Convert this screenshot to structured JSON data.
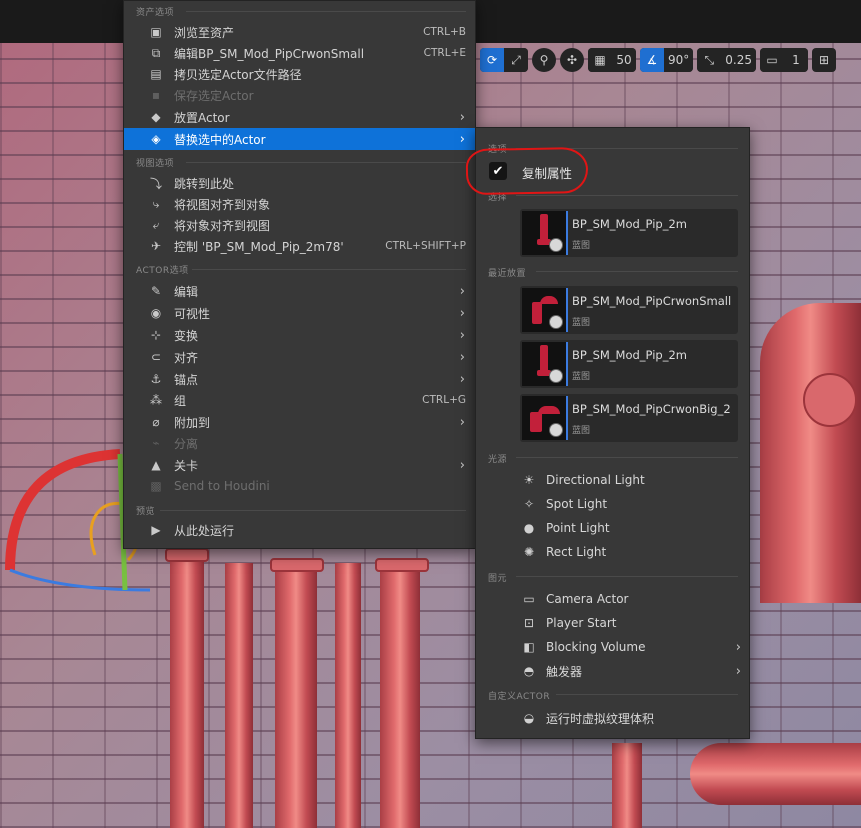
{
  "toolbar": {
    "grid_value": "50",
    "angle_value": "90°",
    "scale_value": "0.25",
    "camera_speed": "1"
  },
  "main_menu": {
    "sections": {
      "asset": "资产选项",
      "view": "视图选项",
      "actor": "ACTOR选项",
      "preview": "预览"
    },
    "items": [
      {
        "label": "浏览至资产",
        "shortcut": "CTRL+B",
        "icon": "browse-icon"
      },
      {
        "label": "编辑BP_SM_Mod_PipCrwonSmall",
        "shortcut": "CTRL+E",
        "icon": "edit-blueprint-icon"
      },
      {
        "label": "拷贝选定Actor文件路径",
        "shortcut": "",
        "icon": "copy-path-icon"
      },
      {
        "label": "保存选定Actor",
        "shortcut": "",
        "icon": "save-icon",
        "disabled": true
      },
      {
        "label": "放置Actor",
        "shortcut": "",
        "icon": "place-actor-icon",
        "submenu": true
      },
      {
        "label": "替换选中的Actor",
        "shortcut": "",
        "icon": "replace-actor-icon",
        "submenu": true,
        "highlighted": true
      },
      {
        "label": "跳转到此处",
        "shortcut": "",
        "icon": "jump-icon"
      },
      {
        "label": "将视图对齐到对象",
        "shortcut": "",
        "icon": "snap-view-icon"
      },
      {
        "label": "将对象对齐到视图",
        "shortcut": "",
        "icon": "snap-object-icon"
      },
      {
        "label": "控制 'BP_SM_Mod_Pip_2m78'",
        "shortcut": "CTRL+SHIFT+P",
        "icon": "pilot-icon"
      },
      {
        "label": "编辑",
        "shortcut": "",
        "icon": "pencil-icon",
        "submenu": true
      },
      {
        "label": "可视性",
        "shortcut": "",
        "icon": "eye-icon",
        "submenu": true
      },
      {
        "label": "变换",
        "shortcut": "",
        "icon": "transform-icon",
        "submenu": true
      },
      {
        "label": "对齐",
        "shortcut": "",
        "icon": "magnet-icon",
        "submenu": true
      },
      {
        "label": "锚点",
        "shortcut": "",
        "icon": "pivot-icon",
        "submenu": true
      },
      {
        "label": "组",
        "shortcut": "CTRL+G",
        "icon": "group-icon"
      },
      {
        "label": "附加到",
        "shortcut": "",
        "icon": "attach-icon",
        "submenu": true
      },
      {
        "label": "分离",
        "shortcut": "",
        "icon": "detach-icon",
        "disabled": true
      },
      {
        "label": "关卡",
        "shortcut": "",
        "icon": "level-icon",
        "submenu": true
      },
      {
        "label": "Send to Houdini",
        "shortcut": "",
        "icon": "houdini-icon",
        "disabled": true
      },
      {
        "label": "从此处运行",
        "shortcut": "",
        "icon": "play-icon"
      }
    ]
  },
  "sub_menu": {
    "sections": {
      "options": "选项",
      "selection": "选择",
      "recent": "最近放置",
      "lights": "光源",
      "basic": "图元",
      "custom": "自定义ACTOR"
    },
    "copy_properties": {
      "label": "复制属性",
      "checked": true
    },
    "selected_asset": {
      "name": "BP_SM_Mod_Pip_2m",
      "type": "蓝图"
    },
    "recent_assets": [
      {
        "name": "BP_SM_Mod_PipCrwonSmall",
        "type": "蓝图"
      },
      {
        "name": "BP_SM_Mod_Pip_2m",
        "type": "蓝图"
      },
      {
        "name": "BP_SM_Mod_PipCrwonBig_2",
        "type": "蓝图"
      }
    ],
    "lights": [
      {
        "label": "Directional Light",
        "icon": "directional-light-icon"
      },
      {
        "label": "Spot Light",
        "icon": "spot-light-icon"
      },
      {
        "label": "Point Light",
        "icon": "point-light-icon"
      },
      {
        "label": "Rect Light",
        "icon": "rect-light-icon"
      }
    ],
    "basic": [
      {
        "label": "Camera Actor",
        "icon": "camera-icon"
      },
      {
        "label": "Player Start",
        "icon": "player-start-icon"
      },
      {
        "label": "Blocking Volume",
        "icon": "blocking-volume-icon",
        "submenu": true
      },
      {
        "label": "触发器",
        "icon": "trigger-icon",
        "submenu": true
      }
    ],
    "custom": [
      {
        "label": "运行时虚拟纹理体积",
        "icon": "rvt-volume-icon"
      }
    ]
  },
  "colors": {
    "highlight": "#0e72d9",
    "menu_bg": "#383838",
    "annotation": "#e01515"
  }
}
